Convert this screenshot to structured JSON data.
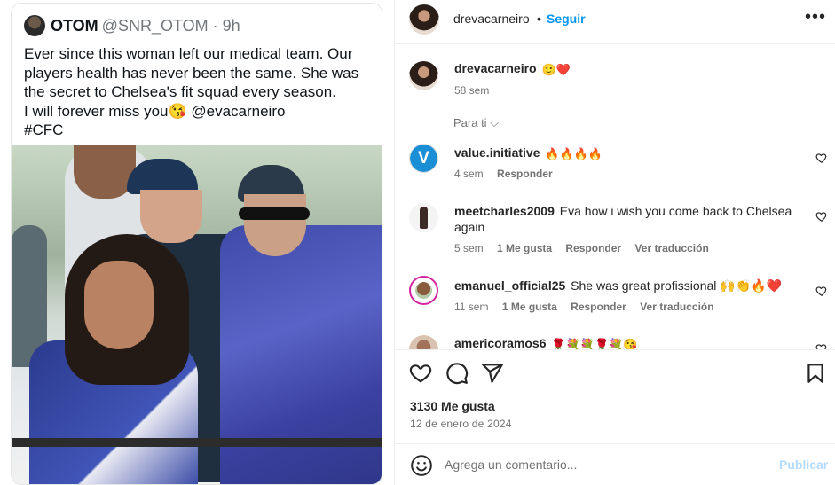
{
  "tweet": {
    "name": "OTOM",
    "handle": "@SNR_OTOM · 9h",
    "lines": [
      "Ever since this woman left our medical team. Our",
      "players health has never been the same. She was",
      "the secret to Chelsea's fit squad every season.",
      "I will forever miss you😘 @evacarneiro",
      "#CFC"
    ]
  },
  "header": {
    "username": "drevacarneiro",
    "separator": "•",
    "follow_label": "Seguir",
    "more_label": "•••"
  },
  "caption": {
    "username": "drevacarneiro",
    "text": "🙂❤️",
    "time": "58 sem"
  },
  "para_ti": "Para ti ⌵",
  "comments": [
    {
      "username": "value.initiative",
      "text": "🔥🔥🔥🔥",
      "meta": {
        "time": "4 sem",
        "likes": "",
        "reply": "Responder",
        "translate": ""
      }
    },
    {
      "username": "meetcharles2009",
      "text": "Eva how i wish you come back to Chelsea again",
      "meta": {
        "time": "5 sem",
        "likes": "1 Me gusta",
        "reply": "Responder",
        "translate": "Ver traducción"
      }
    },
    {
      "username": "emanuel_official25",
      "text": "She was great profissional 🙌👏🔥❤️",
      "meta": {
        "time": "11 sem",
        "likes": "1 Me gusta",
        "reply": "Responder",
        "translate": "Ver traducción"
      }
    },
    {
      "username": "americoramos6",
      "text": "🌹💐💐🌹💐😘",
      "meta": {
        "time": "",
        "likes": "",
        "reply": "",
        "translate": ""
      }
    }
  ],
  "post": {
    "likes": "3130 Me gusta",
    "date": "12 de enero de 2024"
  },
  "comment_box": {
    "placeholder": "Agrega un comentario...",
    "publish_label": "Publicar"
  },
  "icons": {
    "like": "heart-icon",
    "comment": "comment-bubble-icon",
    "share": "paper-plane-icon",
    "save": "bookmark-icon",
    "emoji": "smiley-icon",
    "more": "more-horizontal-icon"
  },
  "colors": {
    "accent": "#0095f6",
    "publish_disabled": "#b3dbff",
    "muted": "#737373",
    "border": "#efefef"
  }
}
